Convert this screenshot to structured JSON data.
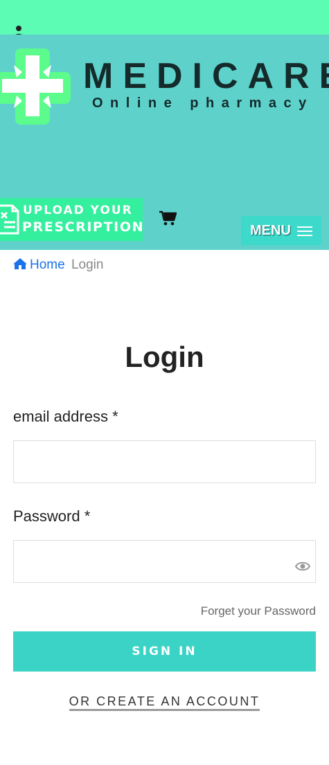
{
  "icons": {
    "top_user": "user-icon",
    "cart": "shopping-cart-icon",
    "menu": "hamburger-icon",
    "home": "home-icon",
    "password_toggle": "eye-icon",
    "upload": "prescription-document-icon",
    "logo": "medical-cross-icon"
  },
  "colors": {
    "topbar_bg": "#5cfcb4",
    "header_bg": "#5ed1cb",
    "upload_bg": "#34ef9e",
    "menu_bg": "#3dd9cb",
    "signin_bg": "#3bd3c6",
    "link_blue": "#1a73e8"
  },
  "header": {
    "brand_name": "MEDICARE",
    "brand_tagline": "Online pharmacy",
    "upload_line1": "UPLOAD YOUR",
    "upload_line2": "PRESCRIPTION",
    "menu_label": "MENU"
  },
  "breadcrumb": {
    "home_label": "Home",
    "current_label": "Login"
  },
  "form": {
    "title": "Login",
    "email_label": "email address *",
    "email_value": "",
    "email_placeholder": "",
    "password_label": "Password *",
    "password_value": "",
    "password_placeholder": "",
    "forgot_label": "Forget your Password",
    "signin_label": "SIGN IN",
    "create_account_label": "OR CREATE AN ACCOUNT"
  }
}
